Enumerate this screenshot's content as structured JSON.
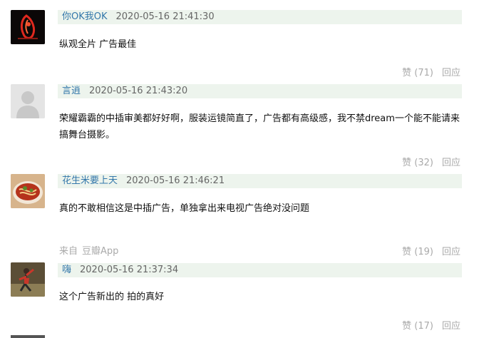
{
  "comments": [
    {
      "author": "你OK我OK",
      "time": "2020-05-16 21:41:30",
      "text": "纵观全片 广告最佳",
      "likes": "赞 (71)",
      "reply": "回应",
      "avatar_icon": "red-neon-figure-avatar"
    },
    {
      "author": "言逍",
      "time": "2020-05-16 21:43:20",
      "text": "荣耀霸霸的中插审美都好好啊，服装运镜简直了，广告都有高级感，我不禁dream一个能不能请来搞舞台摄影。",
      "likes": "赞 (32)",
      "reply": "回应",
      "avatar_icon": "default-user-avatar"
    },
    {
      "author": "花生米要上天",
      "time": "2020-05-16 21:46:21",
      "text": "真的不敢相信这是中插广告，单独拿出来电视广告绝对没问题",
      "likes": "赞 (19)",
      "reply": "回应",
      "avatar_icon": "noodle-bowl-avatar",
      "source_prefix": "来自",
      "source_app": "豆瓣App"
    },
    {
      "author": "嗨",
      "time": "2020-05-16 21:37:34",
      "text": "这个广告新出的 拍的真好",
      "likes": "赞 (17)",
      "reply": "回应",
      "avatar_icon": "dancer-avatar"
    }
  ],
  "colors": {
    "author": "#3377aa",
    "meta_bg": "#edf4ed",
    "muted": "#aaaaaa"
  }
}
